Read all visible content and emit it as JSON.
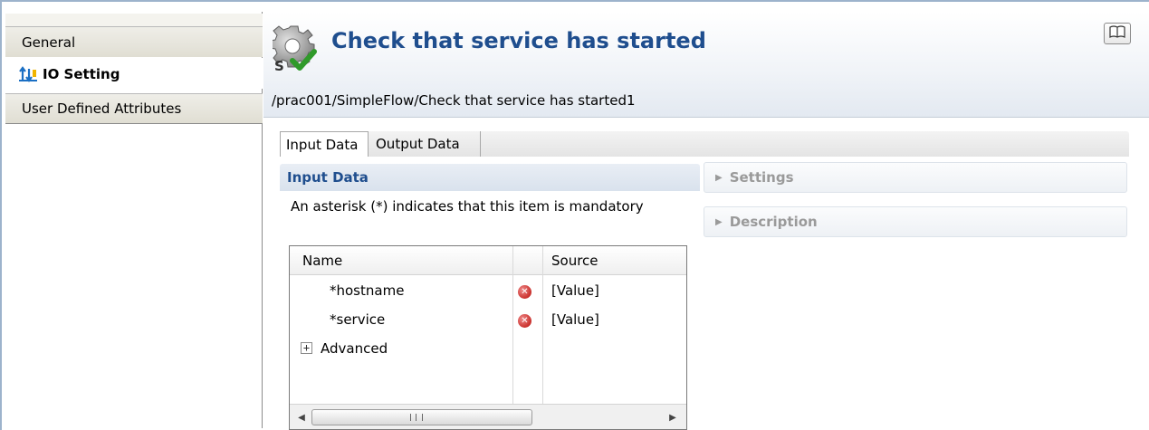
{
  "sidebar": {
    "items": [
      {
        "label": "General",
        "active": false
      },
      {
        "label": "IO Setting",
        "active": true,
        "icon": "io-setting-icon"
      },
      {
        "label": "User Defined Attributes",
        "active": false
      }
    ]
  },
  "header": {
    "title": "Check that service has started",
    "icon": "service-check-icon",
    "path": "/prac001/SimpleFlow/Check that service has started1",
    "help_icon": "book-icon"
  },
  "tabs": [
    {
      "label": "Input Data",
      "selected": true
    },
    {
      "label": "Output Data",
      "selected": false
    }
  ],
  "input_section": {
    "title": "Input Data",
    "note": "An asterisk (*) indicates that this item is mandatory"
  },
  "table": {
    "columns": [
      "Name",
      "",
      "Source"
    ],
    "rows": [
      {
        "name": "*hostname",
        "error": true,
        "source": "[Value]"
      },
      {
        "name": "*service",
        "error": true,
        "source": "[Value]"
      },
      {
        "name": "Advanced",
        "expandable": true,
        "source": ""
      }
    ]
  },
  "right_sections": [
    {
      "label": "Settings",
      "collapsed": true
    },
    {
      "label": "Description",
      "collapsed": true
    }
  ],
  "colors": {
    "title": "#1f4e8e",
    "error": "#c9302c",
    "collapsed_header_text": "#9a9a9a"
  }
}
